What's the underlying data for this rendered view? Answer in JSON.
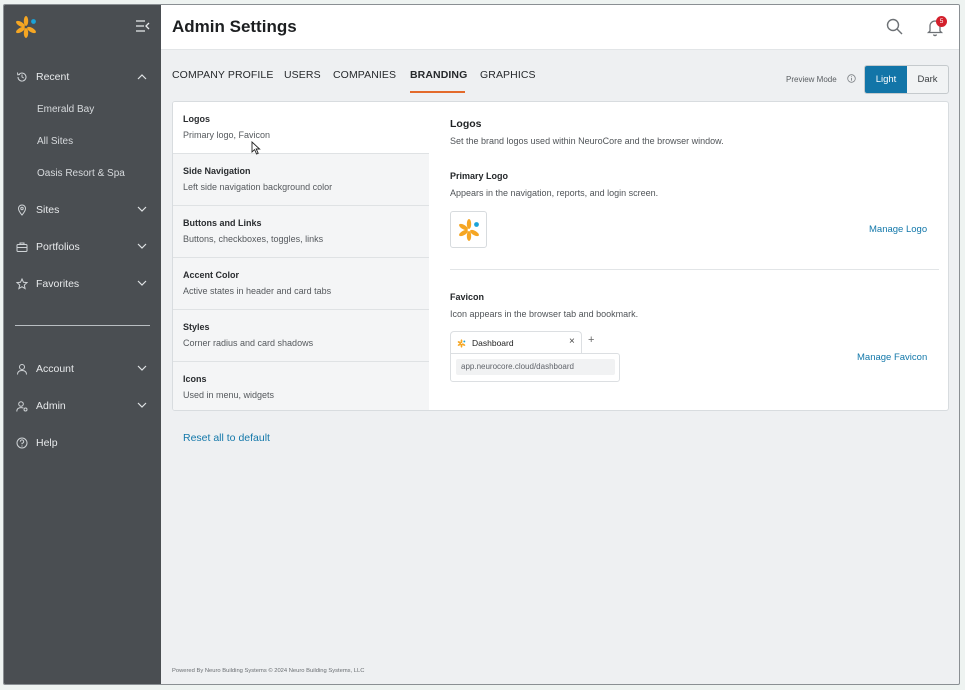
{
  "sidebar": {
    "collapse_icon": "collapse-menu-icon",
    "recent": {
      "label": "Recent",
      "icon": "history-icon",
      "expanded": true,
      "items": [
        "Emerald Bay",
        "All Sites",
        "Oasis Resort & Spa"
      ]
    },
    "sites": {
      "label": "Sites",
      "icon": "location-pin-icon"
    },
    "portfolios": {
      "label": "Portfolios",
      "icon": "briefcase-icon"
    },
    "favorites": {
      "label": "Favorites",
      "icon": "star-icon"
    },
    "account": {
      "label": "Account",
      "icon": "user-icon"
    },
    "admin": {
      "label": "Admin",
      "icon": "admin-user-icon"
    },
    "help": {
      "label": "Help",
      "icon": "help-circle-icon"
    }
  },
  "header": {
    "title": "Admin Settings",
    "notification_count": "5"
  },
  "tabs": [
    "COMPANY PROFILE",
    "USERS",
    "COMPANIES",
    "BRANDING",
    "GRAPHICS"
  ],
  "active_tab": "BRANDING",
  "preview": {
    "label": "Preview Mode",
    "light": "Light",
    "dark": "Dark",
    "selected": "Light"
  },
  "settings_menu": [
    {
      "title": "Logos",
      "subtitle": "Primary logo, Favicon"
    },
    {
      "title": "Side Navigation",
      "subtitle": "Left side navigation background color"
    },
    {
      "title": "Buttons and Links",
      "subtitle": "Buttons, checkboxes, toggles, links"
    },
    {
      "title": "Accent Color",
      "subtitle": "Active states in header and card tabs"
    },
    {
      "title": "Styles",
      "subtitle": "Corner radius and card shadows"
    },
    {
      "title": "Icons",
      "subtitle": "Used in menu, widgets"
    }
  ],
  "content": {
    "title": "Logos",
    "description": "Set the brand logos used within NeuroCore and the browser window.",
    "primary_logo": {
      "title": "Primary Logo",
      "description": "Appears in the navigation, reports, and login screen.",
      "action": "Manage Logo"
    },
    "favicon": {
      "title": "Favicon",
      "description": "Icon appears in the browser tab and bookmark.",
      "action": "Manage Favicon",
      "tab_label": "Dashboard",
      "tab_close": "×",
      "new_tab": "+",
      "url": "app.neurocore.cloud/dashboard"
    }
  },
  "reset_label": "Reset all to default",
  "footer": "Powered By Neuro Building Systems © 2024 Neuro Building Systems, LLC",
  "colors": {
    "sidebar_bg": "#4a4e52",
    "accent": "#e36a2b",
    "primary": "#1275a8",
    "logo_orange": "#f5a623",
    "logo_blue": "#1aa3d9",
    "badge": "#d3202c"
  }
}
